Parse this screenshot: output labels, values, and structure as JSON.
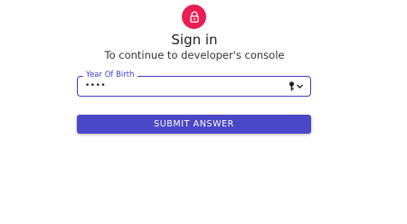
{
  "header": {
    "lock_icon": "lock-icon",
    "avatar_color": "#e81e54",
    "title": "Sign in",
    "subtitle": "To continue to developer's console"
  },
  "form": {
    "year_field": {
      "label": "Year Of Birth",
      "value": "••••",
      "icons": [
        "key-icon",
        "chevron-down-icon"
      ],
      "accent": "#3f3dc4"
    },
    "submit_label": "Submit answer",
    "button_color": "#4a48c6"
  }
}
